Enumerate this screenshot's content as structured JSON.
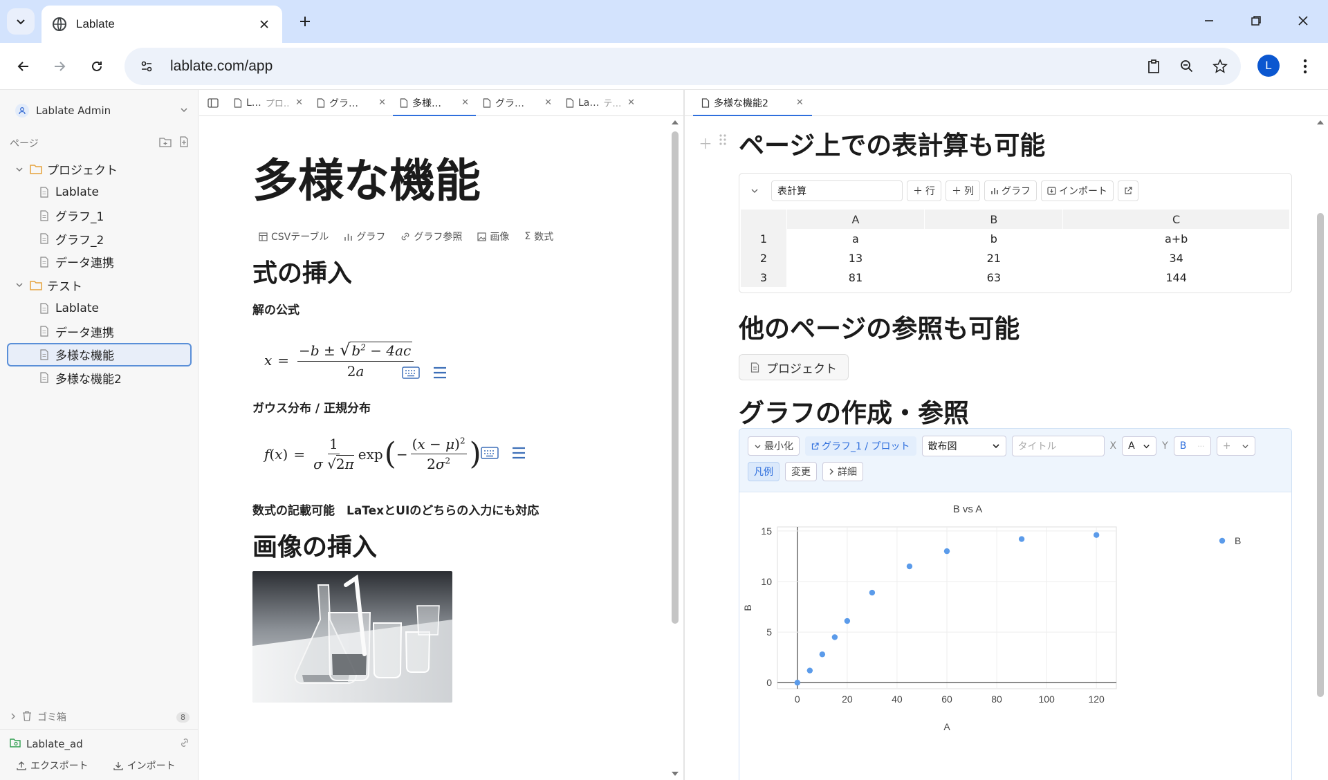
{
  "browser": {
    "tab_title": "Lablate",
    "url": "lablate.com/app",
    "profile_initial": "L"
  },
  "sidebar": {
    "user": "Lablate Admin",
    "pages_label": "ページ",
    "tree": [
      {
        "type": "folder",
        "label": "プロジェクト"
      },
      {
        "type": "page",
        "label": "Lablate"
      },
      {
        "type": "page",
        "label": "グラフ_1"
      },
      {
        "type": "page",
        "label": "グラフ_2"
      },
      {
        "type": "page",
        "label": "データ連携"
      },
      {
        "type": "folder",
        "label": "テスト"
      },
      {
        "type": "page",
        "label": "Lablate"
      },
      {
        "type": "page",
        "label": "データ連携"
      },
      {
        "type": "page",
        "label": "多様な機能",
        "selected": true
      },
      {
        "type": "page",
        "label": "多様な機能2"
      }
    ],
    "trash_label": "ゴミ箱",
    "trash_count": "8",
    "workspace": "Lablate_ad",
    "export_label": "エクスポート",
    "import_label": "インポート"
  },
  "left_pane": {
    "tabs": [
      {
        "title": "L…",
        "sub": "プロ…"
      },
      {
        "title": "グラ…",
        "sub": ""
      },
      {
        "title": "多様…",
        "sub": "",
        "active": true
      },
      {
        "title": "グラ…",
        "sub": ""
      },
      {
        "title": "La…",
        "sub": "テ…"
      }
    ],
    "page_title": "多様な機能",
    "block_tools": [
      "CSVテーブル",
      "グラフ",
      "グラフ参照",
      "画像",
      "数式"
    ],
    "h_formula": "式の挿入",
    "label_quadratic": "解の公式",
    "label_gauss": "ガウス分布 / 正規分布",
    "note": "数式の記載可能　LaTexとUIのどちらの入力にも対応",
    "h_image": "画像の挿入"
  },
  "right_pane": {
    "tab_title": "多様な機能2",
    "h_sheet": "ページ上での表計算も可能",
    "sheet": {
      "name": "表計算",
      "buttons": [
        "行",
        "列",
        "グラフ",
        "インポート"
      ],
      "columns": [
        "A",
        "B",
        "C"
      ],
      "rows": [
        [
          "1",
          "a",
          "b",
          "a+b"
        ],
        [
          "2",
          "13",
          "21",
          "34"
        ],
        [
          "3",
          "81",
          "63",
          "144"
        ]
      ]
    },
    "h_ref": "他のページの参照も可能",
    "page_ref": "プロジェクト",
    "h_graph": "グラフの作成・参照",
    "graph": {
      "minimize": "最小化",
      "link": "グラフ_1 / プロット",
      "type_select": "散布図",
      "title_placeholder": "タイトル",
      "x_label": "X",
      "x_value": "A",
      "y_label": "Y",
      "y_value": "B",
      "plus": "+",
      "legend_btn": "凡例",
      "change_btn": "変更",
      "detail_btn": "詳細"
    }
  },
  "chart_data": {
    "type": "scatter",
    "title": "B vs A",
    "xlabel": "A",
    "ylabel": "B",
    "xlim": [
      -8,
      128
    ],
    "ylim": [
      -0.6,
      15.4
    ],
    "xticks": [
      0,
      20,
      40,
      60,
      80,
      100,
      120
    ],
    "yticks": [
      0,
      5,
      10,
      15
    ],
    "grid": true,
    "legend_position": "top-right",
    "series": [
      {
        "name": "B",
        "color": "#5b9bea",
        "x": [
          0,
          5,
          10,
          15,
          20,
          30,
          45,
          60,
          90,
          120
        ],
        "y": [
          0,
          1.2,
          2.8,
          4.5,
          6.1,
          8.9,
          11.5,
          13.0,
          14.2,
          14.6
        ]
      }
    ]
  }
}
